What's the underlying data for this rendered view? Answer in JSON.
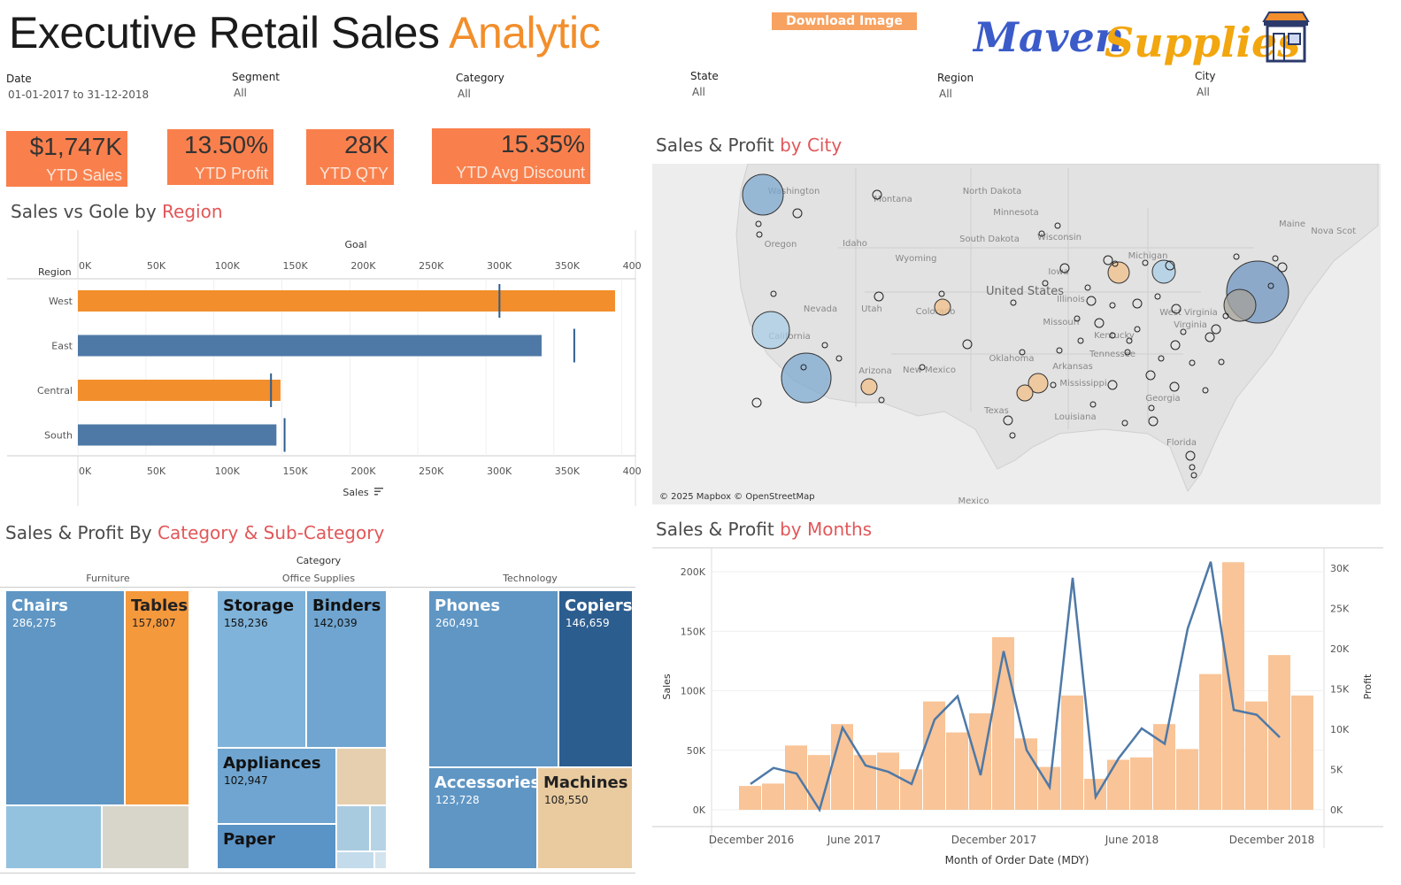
{
  "header": {
    "title_main": "Executive Retail Sales ",
    "title_accent": "Analytic",
    "download_label": "Download Image",
    "logo_word1": "Maven",
    "logo_word2": "Supplies"
  },
  "filters": [
    {
      "label": "Date",
      "value": "01-01-2017 to 31-12-2018"
    },
    {
      "label": "Segment",
      "value": "All"
    },
    {
      "label": "Category",
      "value": "All"
    },
    {
      "label": "State",
      "value": "All"
    },
    {
      "label": "Region",
      "value": "All"
    },
    {
      "label": "City",
      "value": "All"
    }
  ],
  "kpis": [
    {
      "value": "$1,747K",
      "label": "YTD Sales"
    },
    {
      "value": "13.50%",
      "label": "YTD Profit"
    },
    {
      "value": "28K",
      "label": "YTD QTY"
    },
    {
      "value": "15.35%",
      "label": "YTD Avg Discount"
    }
  ],
  "sections": {
    "region": {
      "pre": "Sales vs Gole by ",
      "hl": "Region"
    },
    "city": {
      "pre": "Sales & Profit ",
      "hl": "by City"
    },
    "category": {
      "pre": "Sales & Profit By ",
      "hl": "Category & Sub-Category"
    },
    "months": {
      "pre": "Sales & Profit ",
      "hl": "by Months"
    }
  },
  "colors": {
    "orange": "#f28e2b",
    "blue": "#4e79a7",
    "kpi": "#f9804d",
    "accent": "#e15759"
  },
  "chart_data": [
    {
      "type": "bar",
      "orientation": "horizontal",
      "row_header": "Region",
      "top_axis_label": "Goal",
      "xlabel": "Sales",
      "ticks": [
        "0K",
        "50K",
        "100K",
        "150K",
        "200K",
        "250K",
        "300K",
        "350K",
        "400K"
      ],
      "xlim": [
        0,
        410000
      ],
      "categories": [
        "West",
        "East",
        "Central",
        "South"
      ],
      "values": [
        395000,
        341000,
        149000,
        146000
      ],
      "goals": [
        310000,
        365000,
        142000,
        152000
      ],
      "bar_colors": [
        "#f28e2b",
        "#4e79a7",
        "#f28e2b",
        "#4e79a7"
      ]
    },
    {
      "type": "scatter",
      "map": true,
      "attribution": "© 2025 Mapbox © OpenStreetMap",
      "country_label": "United States",
      "labels": [
        "Washington",
        "Montana",
        "North Dakota",
        "Minnesota",
        "Oregon",
        "Idaho",
        "South Dakota",
        "Wisconsin",
        "Wyoming",
        "Michigan",
        "Iowa",
        "Nevada",
        "Utah",
        "Colorado",
        "Illinois",
        "California",
        "Missouri",
        "West Virginia",
        "Virginia",
        "Kentucky",
        "Arizona",
        "New Mexico",
        "Oklahoma",
        "Arkansas",
        "Tennessee",
        "Mississippi",
        "Georgia",
        "Texas",
        "Louisiana",
        "Florida",
        "Maine",
        "Nova Scot",
        "Mexico"
      ]
    },
    {
      "type": "treemap",
      "header": "Category",
      "categories": [
        "Furniture",
        "Office Supplies",
        "Technology"
      ],
      "items": [
        {
          "name": "Chairs",
          "value": "286,275"
        },
        {
          "name": "Tables",
          "value": "157,807"
        },
        {
          "name": "Storage",
          "value": "158,236"
        },
        {
          "name": "Binders",
          "value": "142,039"
        },
        {
          "name": "Appliances",
          "value": "102,947"
        },
        {
          "name": "Paper",
          "value": ""
        },
        {
          "name": "Phones",
          "value": "260,491"
        },
        {
          "name": "Copiers",
          "value": "146,659"
        },
        {
          "name": "Accessories",
          "value": "123,728"
        },
        {
          "name": "Machines",
          "value": "108,550"
        }
      ]
    },
    {
      "type": "bar",
      "combo_line": true,
      "xlabel": "Month of Order Date (MDY)",
      "ylabel": "Sales",
      "y2label": "Profit",
      "x_ticks": [
        "December 2016",
        "June 2017",
        "December 2017",
        "June 2018",
        "December 2018"
      ],
      "y_ticks": [
        "0K",
        "50K",
        "100K",
        "150K",
        "200K"
      ],
      "y2_ticks": [
        "0K",
        "5K",
        "10K",
        "15K",
        "20K",
        "25K",
        "30K"
      ],
      "ylim": [
        0,
        210000
      ],
      "y2lim": [
        0,
        31000
      ],
      "sales": [
        20000,
        22000,
        54000,
        46000,
        72000,
        46000,
        48000,
        34000,
        91000,
        65000,
        81000,
        145000,
        60000,
        36000,
        96000,
        26000,
        42000,
        44000,
        72000,
        51000,
        114000,
        208000,
        91000,
        130000,
        96000
      ],
      "profit": [
        3200,
        5200,
        4500,
        0,
        10200,
        5500,
        4700,
        3200,
        11200,
        14100,
        4300,
        19700,
        7400,
        2800,
        28800,
        1600,
        6400,
        10100,
        8200,
        22500,
        30800,
        12400,
        11800,
        9000
      ]
    }
  ]
}
